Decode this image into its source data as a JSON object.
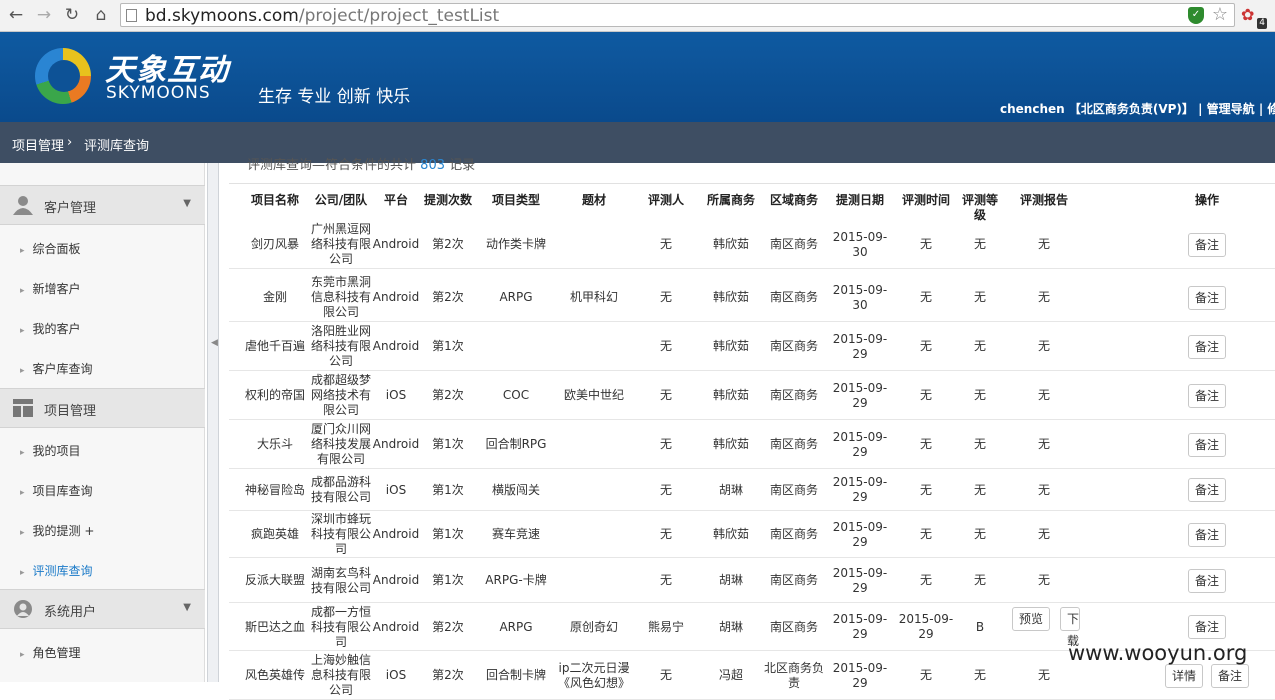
{
  "browser": {
    "url_host": "bd.skymoons.com",
    "url_path": "/project/project_testList",
    "ext_badge": "4"
  },
  "header": {
    "logo_cn": "天象互动",
    "logo_en": "SKYMOONS",
    "slogan": "生存 专业 创新 快乐",
    "user_links": "chenchen 【北区商务负责(VP)】 | 管理导航 | 修改密"
  },
  "breadcrumb": {
    "item1": "项目管理",
    "item2": "评测库查询"
  },
  "sidebar": {
    "groups": [
      {
        "label": "客户管理",
        "icon": "user-icon"
      },
      {
        "label": "项目管理",
        "icon": "project-icon"
      },
      {
        "label": "系统用户",
        "icon": "system-user-icon"
      }
    ],
    "items": [
      "综合面板",
      "新增客户",
      "我的客户",
      "客户库查询",
      "我的项目",
      "项目库查询",
      "我的提测 +",
      "评测库查询",
      "角色管理"
    ]
  },
  "result": {
    "prefix": "评测库查询",
    "middle": "—符合条件的共计",
    "count": "803",
    "suffix": "记录"
  },
  "table": {
    "headers": [
      "项目名称",
      "公司/团队",
      "平台",
      "提测次数",
      "项目类型",
      "题材",
      "评测人",
      "所属商务",
      "区域商务",
      "提测日期",
      "评测时间",
      "评测等级",
      "评测报告",
      "操作"
    ],
    "rows": [
      [
        "剑刃风暴",
        "广州黑逗网络科技有限公司",
        "Android",
        "第2次",
        "动作类卡牌",
        "",
        "无",
        "韩欣茹",
        "南区商务",
        "2015-09-30",
        "无",
        "无",
        "无"
      ],
      [
        "金刚",
        "东莞市黑洞信息科技有限公司",
        "Android",
        "第2次",
        "ARPG",
        "机甲科幻",
        "无",
        "韩欣茹",
        "南区商务",
        "2015-09-30",
        "无",
        "无",
        "无"
      ],
      [
        "虐他千百遍",
        "洛阳胜业网络科技有限公司",
        "Android",
        "第1次",
        "",
        "",
        "无",
        "韩欣茹",
        "南区商务",
        "2015-09-29",
        "无",
        "无",
        "无"
      ],
      [
        "权利的帝国",
        "成都超级梦网络技术有限公司",
        "iOS",
        "第2次",
        "COC",
        "欧美中世纪",
        "无",
        "韩欣茹",
        "南区商务",
        "2015-09-29",
        "无",
        "无",
        "无"
      ],
      [
        "大乐斗",
        "厦门众川网络科技发展有限公司",
        "Android",
        "第1次",
        "回合制RPG",
        "",
        "无",
        "韩欣茹",
        "南区商务",
        "2015-09-29",
        "无",
        "无",
        "无"
      ],
      [
        "神秘冒险岛",
        "成都品游科技有限公司",
        "iOS",
        "第1次",
        "横版闯关",
        "",
        "无",
        "胡琳",
        "南区商务",
        "2015-09-29",
        "无",
        "无",
        "无"
      ],
      [
        "疯跑英雄",
        "深圳市蜂玩科技有限公司",
        "Android",
        "第1次",
        "赛车竞速",
        "",
        "无",
        "韩欣茹",
        "南区商务",
        "2015-09-29",
        "无",
        "无",
        "无"
      ],
      [
        "反派大联盟",
        "湖南玄鸟科技有限公司",
        "Android",
        "第1次",
        "ARPG-卡牌",
        "",
        "无",
        "胡琳",
        "南区商务",
        "2015-09-29",
        "无",
        "无",
        "无"
      ],
      [
        "斯巴达之血",
        "成都一方恒科技有限公司",
        "Android",
        "第2次",
        "ARPG",
        "原创奇幻",
        "熊易宁",
        "胡琳",
        "南区商务",
        "2015-09-29",
        "2015-09-29",
        "B",
        ""
      ],
      [
        "风色英雄传",
        "上海妙触信息科技有限公司",
        "iOS",
        "第2次",
        "回合制卡牌",
        "ip二次元日漫《风色幻想》",
        "无",
        "冯超",
        "北区商务负责",
        "2015-09-29",
        "无",
        "无",
        "无"
      ]
    ],
    "note_button": "备注",
    "detail_button": "详情",
    "preview_button": "预览",
    "download_button": "下载"
  },
  "watermark": "www.wooyun.org"
}
